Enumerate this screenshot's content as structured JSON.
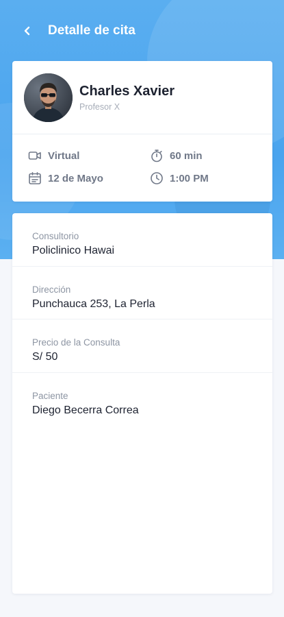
{
  "header": {
    "title": "Detalle de cita"
  },
  "doctor": {
    "name": "Charles Xavier",
    "subtitle": "Profesor X"
  },
  "appointment": {
    "mode": "Virtual",
    "duration": "60 min",
    "date": "12 de Mayo",
    "time": "1:00 PM"
  },
  "details": [
    {
      "label": "Consultorio",
      "value": "Policlinico Hawai"
    },
    {
      "label": "Dirección",
      "value": "Punchauca 253, La Perla"
    },
    {
      "label": "Precio de la Consulta",
      "value": "S/ 50"
    },
    {
      "label": "Paciente",
      "value": "Diego Becerra Correa"
    }
  ],
  "colors": {
    "header_bg": "#4aa4ee",
    "icon": "#707888",
    "text_dark": "#1d2230",
    "text_muted": "#8d95a3"
  },
  "icons": {
    "back": "chevron-left-icon",
    "mode": "video-camera-icon",
    "duration": "stopwatch-icon",
    "date": "calendar-icon",
    "time": "clock-icon"
  }
}
